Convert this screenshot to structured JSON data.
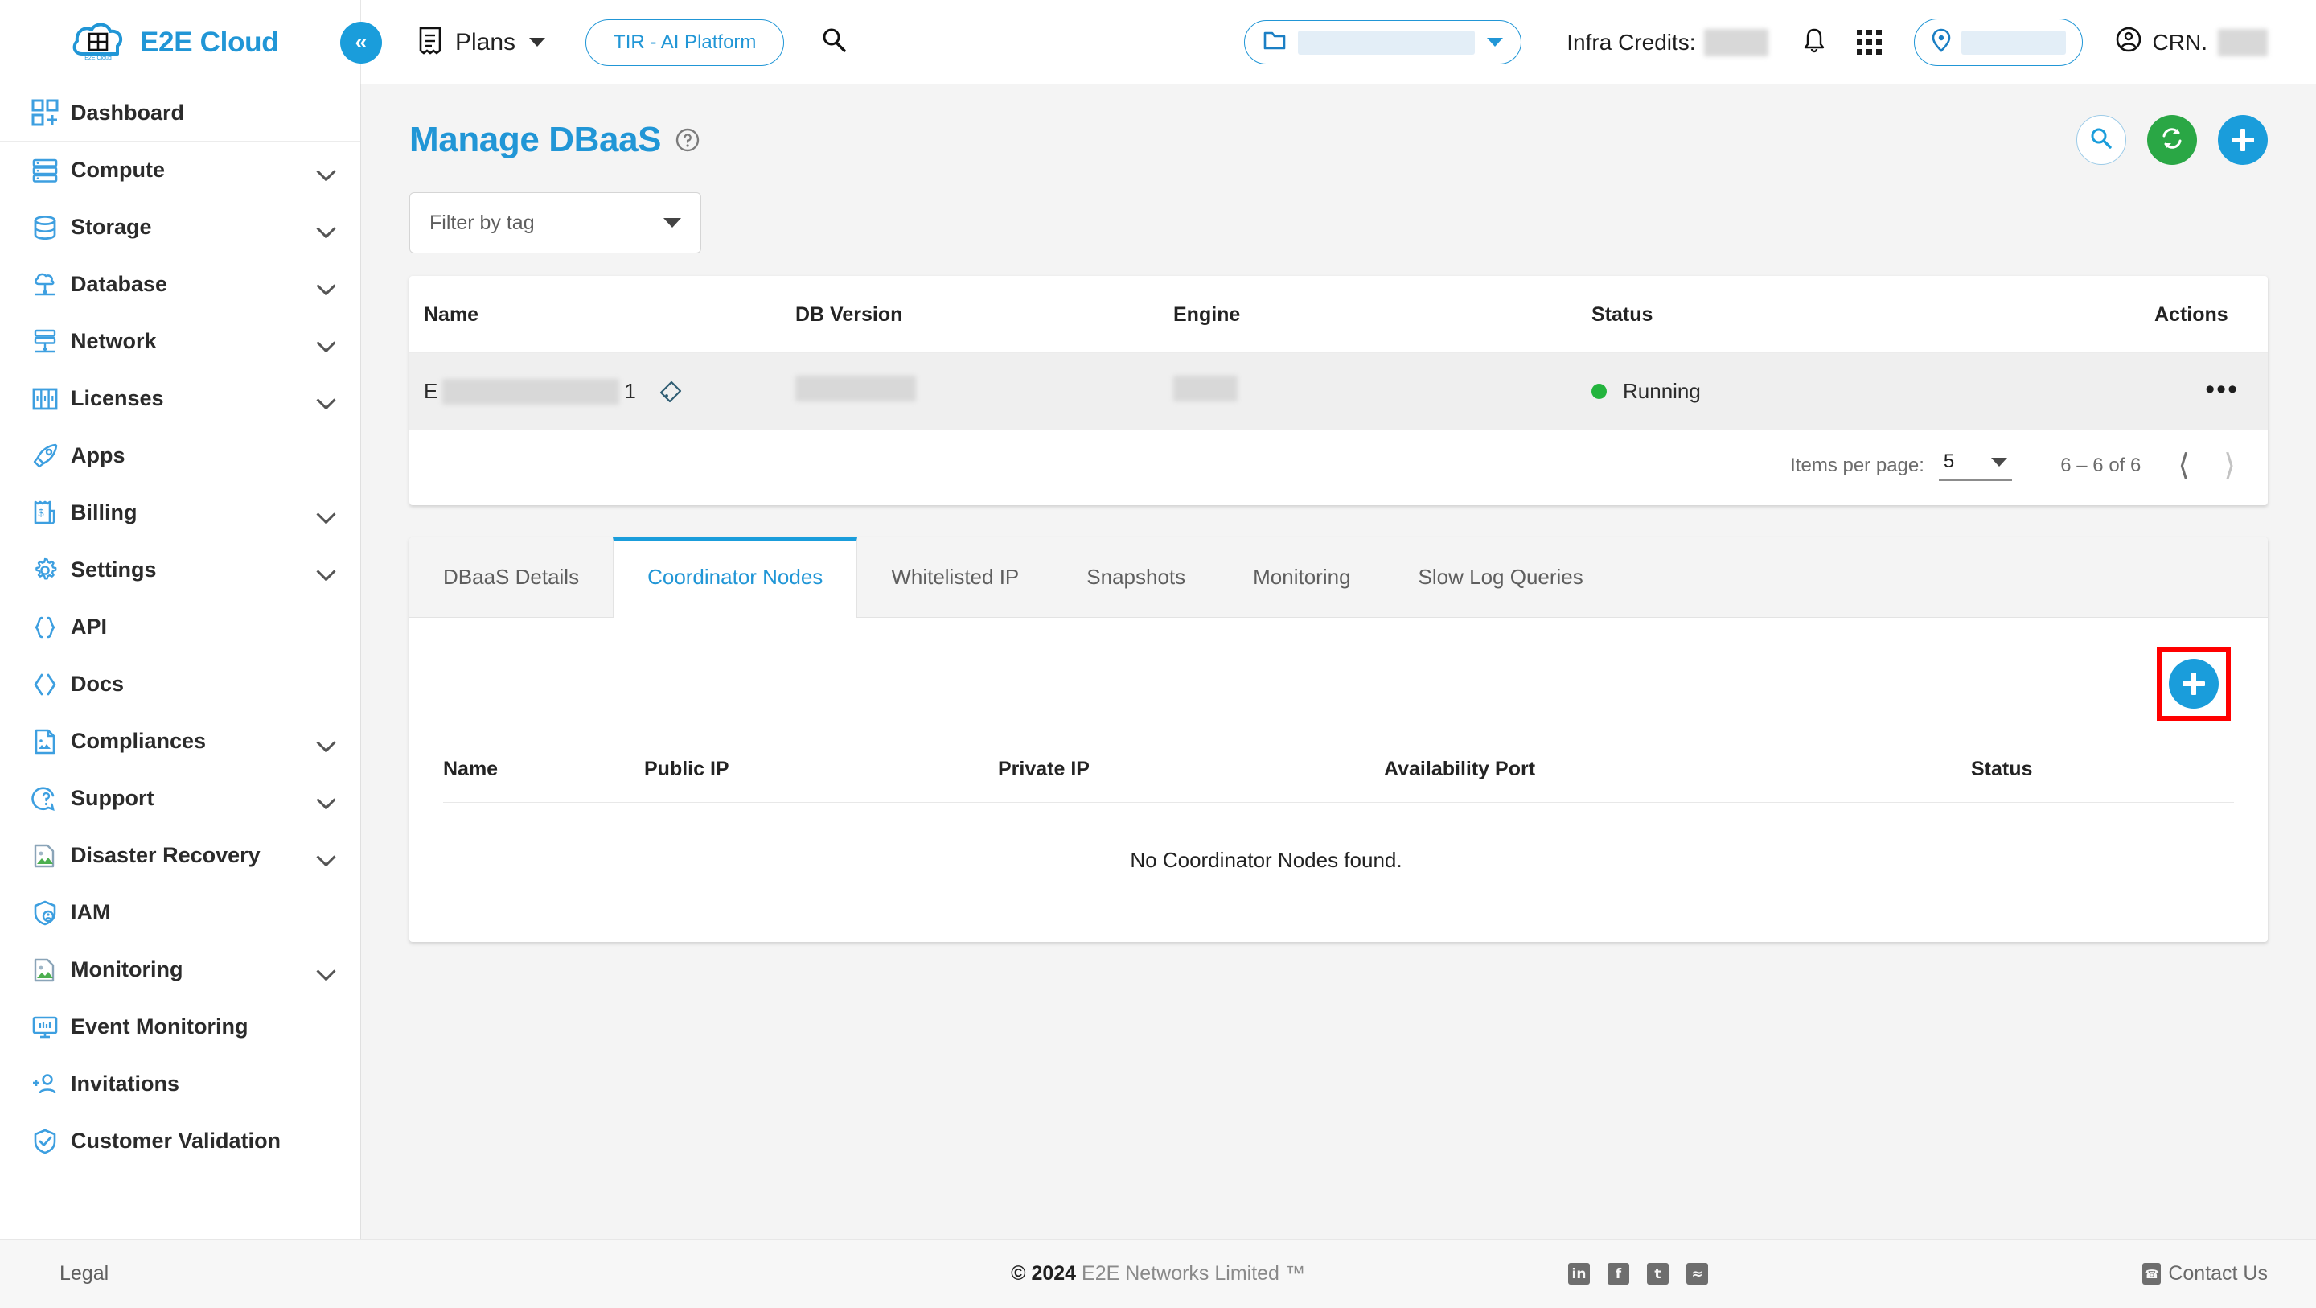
{
  "topbar": {
    "brand": "E2E Cloud",
    "brand_logo_caption": "E2E Cloud",
    "collapse_icon": "double-chevron-left-icon",
    "plans_label": "Plans",
    "tir_button": "TIR - AI Platform",
    "search_icon": "search-icon",
    "project_selector": {
      "icon": "folder-icon",
      "value": "",
      "caret": "chevron-down-icon"
    },
    "infra_credits_label": "Infra Credits:",
    "infra_credits_value": "",
    "notifications_icon": "bell-icon",
    "apps_grid_icon": "apps-grid-icon",
    "region_selector": {
      "icon": "location-pin-icon",
      "value": ""
    },
    "crn_label": "CRN.",
    "crn_value": "",
    "account_icon": "user-circle-icon"
  },
  "sidebar": {
    "items": [
      {
        "label": "Dashboard",
        "icon": "dashboard-icon",
        "expandable": false
      },
      {
        "label": "Compute",
        "icon": "server-icon",
        "expandable": true
      },
      {
        "label": "Storage",
        "icon": "database-cylinder-icon",
        "expandable": true
      },
      {
        "label": "Database",
        "icon": "cloud-database-icon",
        "expandable": true
      },
      {
        "label": "Network",
        "icon": "network-icon",
        "expandable": true
      },
      {
        "label": "Licenses",
        "icon": "licenses-grid-icon",
        "expandable": true
      },
      {
        "label": "Apps",
        "icon": "rocket-icon",
        "expandable": false
      },
      {
        "label": "Billing",
        "icon": "billing-receipt-icon",
        "expandable": true
      },
      {
        "label": "Settings",
        "icon": "gear-icon",
        "expandable": true
      },
      {
        "label": "API",
        "icon": "curly-braces-icon",
        "expandable": false
      },
      {
        "label": "Docs",
        "icon": "code-brackets-icon",
        "expandable": false
      },
      {
        "label": "Compliances",
        "icon": "document-icon",
        "expandable": true
      },
      {
        "label": "Support",
        "icon": "support-question-icon",
        "expandable": true
      },
      {
        "label": "Disaster Recovery",
        "icon": "image-document-icon",
        "expandable": true
      },
      {
        "label": "IAM",
        "icon": "shield-user-icon",
        "expandable": false
      },
      {
        "label": "Monitoring",
        "icon": "image-document-icon",
        "expandable": true
      },
      {
        "label": "Event Monitoring",
        "icon": "monitor-chart-icon",
        "expandable": false
      },
      {
        "label": "Invitations",
        "icon": "add-user-icon",
        "expandable": false
      },
      {
        "label": "Customer Validation",
        "icon": "shield-check-icon",
        "expandable": false
      }
    ]
  },
  "page": {
    "title": "Manage DBaaS",
    "help_icon": "question-circle-icon",
    "actions": [
      {
        "name": "search",
        "icon": "search-icon",
        "color": "#ffffff"
      },
      {
        "name": "refresh",
        "icon": "refresh-icon",
        "color": "#2aa745"
      },
      {
        "name": "add",
        "icon": "plus-icon",
        "color": "#1a9ddb"
      }
    ],
    "filter": {
      "placeholder": "Filter by tag",
      "value": "",
      "caret": "caret-down-icon"
    }
  },
  "dbaas_table": {
    "columns": [
      "Name",
      "DB Version",
      "Engine",
      "Status",
      "Actions"
    ],
    "rows": [
      {
        "name_prefix": "E",
        "name_redacted": true,
        "name_suffix": "1",
        "tag_icon": "tag-icon",
        "db_version": "",
        "engine": "",
        "status": "Running",
        "status_color": "#23b43d",
        "actions_icon": "more-horizontal-icon"
      }
    ],
    "pagination": {
      "items_per_page_label": "Items per page:",
      "items_per_page_value": "5",
      "range": "6 – 6 of 6",
      "prev_icon": "chevron-left-icon",
      "next_icon": "chevron-right-icon"
    }
  },
  "panel": {
    "tabs": [
      {
        "label": "DBaaS Details",
        "active": false
      },
      {
        "label": "Coordinator Nodes",
        "active": true
      },
      {
        "label": "Whitelisted IP",
        "active": false
      },
      {
        "label": "Snapshots",
        "active": false
      },
      {
        "label": "Monitoring",
        "active": false
      },
      {
        "label": "Slow Log Queries",
        "active": false
      }
    ],
    "add_button": {
      "icon": "plus-icon",
      "highlighted": true,
      "highlight_color": "#ff0000"
    },
    "node_table": {
      "columns": [
        "Name",
        "Public IP",
        "Private IP",
        "Availability Port",
        "Status"
      ],
      "empty_message": "No Coordinator Nodes found."
    }
  },
  "footer": {
    "legal": "Legal",
    "copyright_symbol": "©",
    "copyright_year": "2024",
    "copyright_text": "E2E Networks Limited ™",
    "socials": [
      {
        "name": "linkedin-icon",
        "glyph": "in"
      },
      {
        "name": "facebook-icon",
        "glyph": "f"
      },
      {
        "name": "twitter-icon",
        "glyph": "t"
      },
      {
        "name": "rss-icon",
        "glyph": "≈"
      }
    ],
    "contact": "Contact Us",
    "contact_icon": "phone-icon"
  },
  "colors": {
    "accent_blue": "#2196d6",
    "fab_blue": "#1a9ddb",
    "green": "#2aa745",
    "status_green": "#23b43d",
    "highlight_red": "#ff0000",
    "page_bg": "#f4f4f4"
  }
}
